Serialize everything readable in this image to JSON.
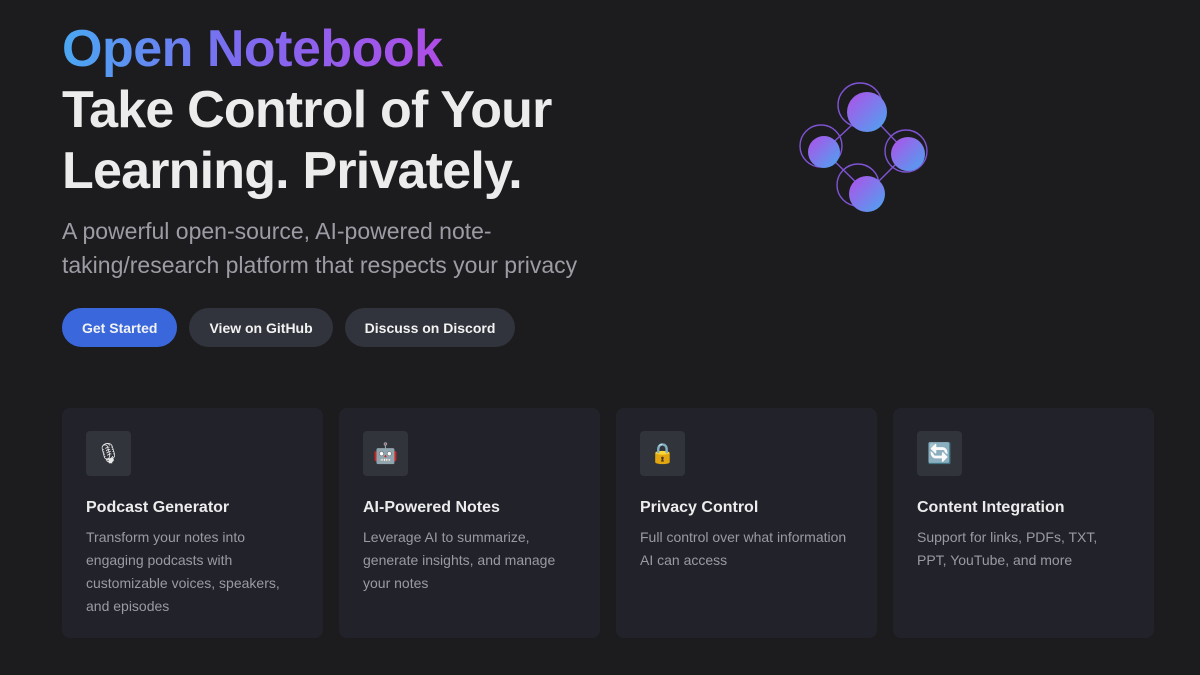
{
  "hero": {
    "brand": "Open Notebook",
    "headline_line1": "Take Control of Your",
    "headline_line2": "Learning. Privately.",
    "subtitle": "A powerful open-source, AI-powered note-taking/research platform that respects your privacy"
  },
  "actions": {
    "get_started": "Get Started",
    "github": "View on GitHub",
    "discord": "Discuss on Discord"
  },
  "features": [
    {
      "icon": "microphone-icon",
      "glyph": "🎙",
      "title": "Podcast Generator",
      "description": "Transform your notes into engaging podcasts with customizable voices, speakers, and episodes"
    },
    {
      "icon": "robot-icon",
      "glyph": "🤖",
      "title": "AI-Powered Notes",
      "description": "Leverage AI to summarize, generate insights, and manage your notes"
    },
    {
      "icon": "lock-icon",
      "glyph": "🔒",
      "title": "Privacy Control",
      "description": "Full control over what information AI can access"
    },
    {
      "icon": "refresh-icon",
      "glyph": "🔄",
      "title": "Content Integration",
      "description": "Support for links, PDFs, TXT, PPT, YouTube, and more"
    }
  ],
  "colors": {
    "background": "#1c1c1f",
    "primary_button": "#3a68dc",
    "secondary_button": "#31343c",
    "card": "#22232a",
    "brand_gradient_start": "#4aa8f2",
    "brand_gradient_end": "#b04ce6"
  }
}
